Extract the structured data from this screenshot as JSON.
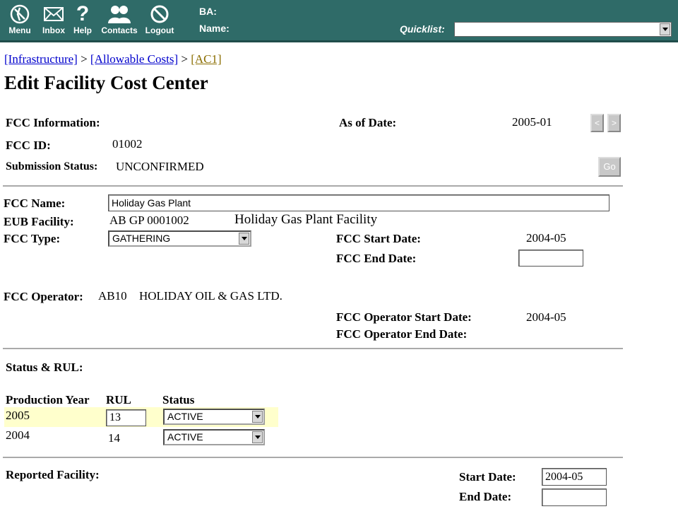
{
  "toolbar": {
    "items": [
      {
        "label": "Menu",
        "icon": "menu-compass-icon"
      },
      {
        "label": "Inbox",
        "icon": "envelope-icon"
      },
      {
        "label": "Help",
        "icon": "question-icon"
      },
      {
        "label": "Contacts",
        "icon": "people-icon"
      },
      {
        "label": "Logout",
        "icon": "no-entry-icon"
      }
    ],
    "ba_label": "BA:",
    "name_label": "Name:",
    "quicklist_label": "Quicklist:",
    "quicklist_value": ""
  },
  "breadcrumb": {
    "items": [
      "[Infrastructure]",
      "[Allowable Costs]",
      "[AC1]"
    ],
    "separator": ">"
  },
  "page_title": "Edit Facility Cost Center",
  "fcc_info": {
    "section_label": "FCC Information:",
    "as_of_label": "As of Date:",
    "as_of_value": "2005-01",
    "prev_button": "<",
    "next_button": ">",
    "id_label": "FCC ID:",
    "id_value": "01002",
    "submission_label": "Submission Status:",
    "submission_value": "UNCONFIRMED",
    "go_button": "Go"
  },
  "fcc_details": {
    "name_label": "FCC Name:",
    "name_value": "Holiday Gas Plant",
    "eub_label": "EUB Facility:",
    "eub_code": "AB GP 0001002",
    "eub_name": "Holiday Gas Plant Facility",
    "type_label": "FCC Type:",
    "type_value": "GATHERING",
    "start_label": "FCC Start Date:",
    "start_value": "2004-05",
    "end_label": "FCC End Date:",
    "end_value": "",
    "operator_label": "FCC Operator:",
    "operator_code": "AB10",
    "operator_name": "HOLIDAY OIL & GAS LTD.",
    "op_start_label": "FCC Operator Start Date:",
    "op_start_value": "2004-05",
    "op_end_label": "FCC Operator End Date:",
    "op_end_value": ""
  },
  "status_rul": {
    "section_label": "Status & RUL:",
    "headers": [
      "Production Year",
      "RUL",
      "Status"
    ],
    "rows": [
      {
        "year": "2005",
        "rul": "13",
        "status": "ACTIVE"
      },
      {
        "year": "2004",
        "rul": "14",
        "status": "ACTIVE"
      }
    ]
  },
  "reported": {
    "section_label": "Reported Facility:",
    "start_label": "Start Date:",
    "start_value": "2004-05",
    "end_label": "End Date:",
    "end_value": ""
  },
  "colors": {
    "toolbar_bg": "#2f6b68",
    "highlight_row": "#ffffcc",
    "link": "#0000cc",
    "current_crumb": "#8a6d00"
  }
}
